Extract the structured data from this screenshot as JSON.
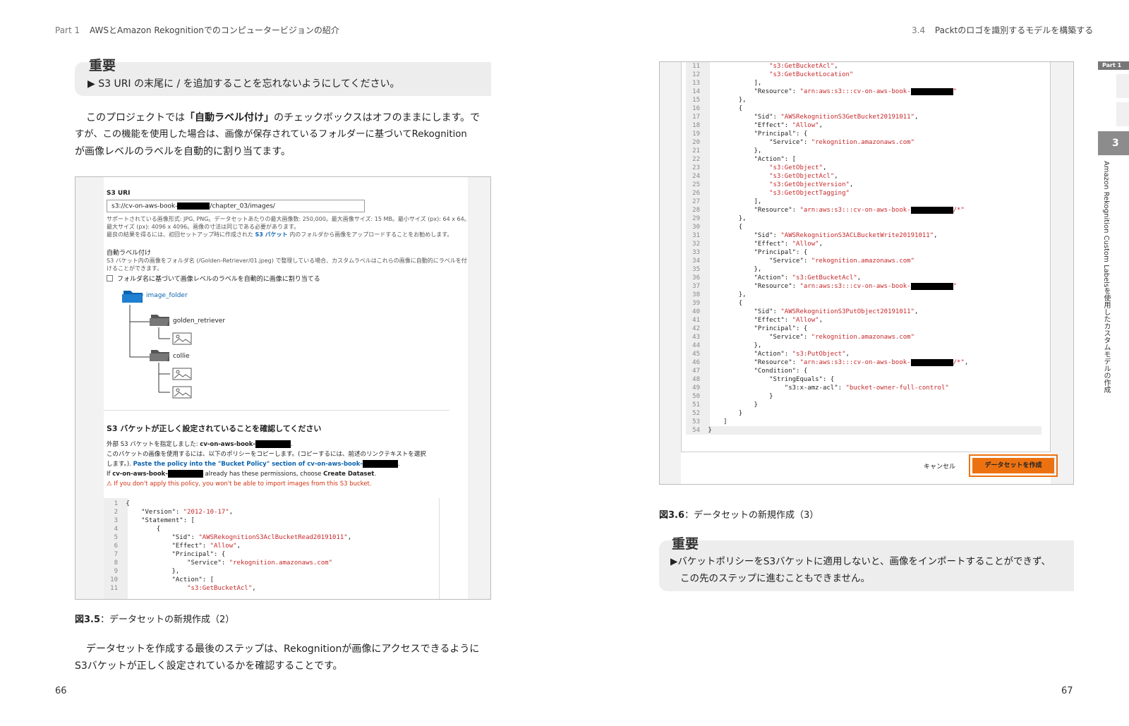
{
  "left_page": {
    "header": {
      "part": "Part 1",
      "title": "AWSとAmazon Rekognitionでのコンピュータービジョンの紹介"
    },
    "note": {
      "title": "重要",
      "text": "▶ S3 URI の末尾に / を追加することを忘れないようにしてください。"
    },
    "paragraph1": {
      "line1_pre": "このプロジェクトでは",
      "line1_bold": "「自動ラベル付け」",
      "line1_post": "のチェックボックスはオフのままにします。で",
      "line2": "すが、この機能を使用した場合は、画像が保存されているフォルダーに基づいてRekognition",
      "line3": "が画像レベルのラベルを自動的に割り当てます。"
    },
    "screenshot": {
      "s3_uri_label": "S3 URI",
      "s3_uri_prefix": "s3://cv-on-aws-book-",
      "s3_uri_suffix": "/chapter_03/images/",
      "help1": "サポートされている画像形式: JPG, PNG。データセットあたりの最大画像数: 250,000。最大画像サイズ: 15 MB。最小サイズ (px): 64 x 64。",
      "help2": "最大サイズ (px): 4096 x 4096。画像の寸法は同じである必要があります。",
      "help3_pre": "最良の結果を得るには、初回セットアップ時に作成された ",
      "help3_link": "S3 バケット",
      "help3_post": " 内のフォルダから画像をアップロードすることをお勧めします。",
      "auto_label_title": "自動ラベル付け",
      "auto_label_desc1": "S3 バケット内の画像をフォルダ名 (/Golden-Retriever/01.jpeg) で整理している場合、カスタムラベルはこれらの画像に自動的にラベルを付",
      "auto_label_desc2": "けることができます。",
      "checkbox_label": "フォルダ名に基づいて画像レベルのラベルを自動的に画像に割り当てる",
      "tree": {
        "root": "image_folder",
        "folder1": "golden_retriever",
        "folder2": "collie"
      },
      "bucket_title": "S3 バケットが正しく設定されていることを確認してください",
      "bucket_line1_pre": "外部 S3 バケットを指定しました: ",
      "bucket_line1_bold": "cv-on-aws-book-",
      "bucket_line2": "このバケットの画像を使用するには、以下のポリシーをコピーします。(コピーするには、前述のリンクテキストを選択",
      "bucket_line3_pre": "します。). ",
      "bucket_line3_link": "Paste the policy into the \"Bucket Policy\" section of cv-on-aws-book-",
      "bucket_line4_pre": "If ",
      "bucket_line4_bold": "cv-on-aws-book-",
      "bucket_line4_post": " already has these permissions, choose ",
      "bucket_line4_bold2": "Create Dataset",
      "warning": "If you don't apply this policy, you won't be able to import images from this S3 bucket.",
      "code": [
        {
          "n": "1",
          "t": "{"
        },
        {
          "n": "2",
          "t": "    \"Version\": ",
          "s": "\"2012-10-17\"",
          "e": ","
        },
        {
          "n": "3",
          "t": "    \"Statement\": ["
        },
        {
          "n": "4",
          "t": "        {"
        },
        {
          "n": "5",
          "t": "            \"Sid\": ",
          "s": "\"AWSRekognitionS3AclBucketRead20191011\"",
          "e": ","
        },
        {
          "n": "6",
          "t": "            \"Effect\": ",
          "s": "\"Allow\"",
          "e": ","
        },
        {
          "n": "7",
          "t": "            \"Principal\": {"
        },
        {
          "n": "8",
          "t": "                \"Service\": ",
          "s": "\"rekognition.amazonaws.com\""
        },
        {
          "n": "9",
          "t": "            },"
        },
        {
          "n": "10",
          "t": "            \"Action\": ["
        },
        {
          "n": "11",
          "t": "                ",
          "s": "\"s3:GetBucketAcl\"",
          "e": ","
        }
      ]
    },
    "caption": {
      "label": "図3.5",
      "text": "：データセットの新規作成（2）"
    },
    "paragraph2": {
      "line1": "データセットを作成する最後のステップは、Rekognitionが画像にアクセスできるように",
      "line2": "S3バケットが正しく設定されているかを確認することです。"
    },
    "page_number": "66"
  },
  "right_page": {
    "header": {
      "section": "3.4",
      "title": "Packtのロゴを識別するモデルを構築する"
    },
    "code": [
      {
        "n": "11",
        "t": "                ",
        "s": "\"s3:GetBucketAcl\"",
        "e": ","
      },
      {
        "n": "12",
        "t": "                ",
        "s": "\"s3:GetBucketLocation\""
      },
      {
        "n": "13",
        "t": "            ],"
      },
      {
        "n": "14",
        "t": "            \"Resource\": ",
        "s": "\"arn:aws:s3:::cv-on-aws-book-",
        "r": true,
        "s2": "\""
      },
      {
        "n": "15",
        "t": "        },"
      },
      {
        "n": "16",
        "t": "        {"
      },
      {
        "n": "17",
        "t": "            \"Sid\": ",
        "s": "\"AWSRekognitionS3GetBucket20191011\"",
        "e": ","
      },
      {
        "n": "18",
        "t": "            \"Effect\": ",
        "s": "\"Allow\"",
        "e": ","
      },
      {
        "n": "19",
        "t": "            \"Principal\": {"
      },
      {
        "n": "20",
        "t": "                \"Service\": ",
        "s": "\"rekognition.amazonaws.com\""
      },
      {
        "n": "21",
        "t": "            },"
      },
      {
        "n": "22",
        "t": "            \"Action\": ["
      },
      {
        "n": "23",
        "t": "                ",
        "s": "\"s3:GetObject\"",
        "e": ","
      },
      {
        "n": "24",
        "t": "                ",
        "s": "\"s3:GetObjectAcl\"",
        "e": ","
      },
      {
        "n": "25",
        "t": "                ",
        "s": "\"s3:GetObjectVersion\"",
        "e": ","
      },
      {
        "n": "26",
        "t": "                ",
        "s": "\"s3:GetObjectTagging\""
      },
      {
        "n": "27",
        "t": "            ],"
      },
      {
        "n": "28",
        "t": "            \"Resource\": ",
        "s": "\"arn:aws:s3:::cv-on-aws-book-",
        "r": true,
        "s2": "/*\""
      },
      {
        "n": "29",
        "t": "        },"
      },
      {
        "n": "30",
        "t": "        {"
      },
      {
        "n": "31",
        "t": "            \"Sid\": ",
        "s": "\"AWSRekognitionS3ACLBucketWrite20191011\"",
        "e": ","
      },
      {
        "n": "32",
        "t": "            \"Effect\": ",
        "s": "\"Allow\"",
        "e": ","
      },
      {
        "n": "33",
        "t": "            \"Principal\": {"
      },
      {
        "n": "34",
        "t": "                \"Service\": ",
        "s": "\"rekognition.amazonaws.com\""
      },
      {
        "n": "35",
        "t": "            },"
      },
      {
        "n": "36",
        "t": "            \"Action\": ",
        "s": "\"s3:GetBucketAcl\"",
        "e": ","
      },
      {
        "n": "37",
        "t": "            \"Resource\": ",
        "s": "\"arn:aws:s3:::cv-on-aws-book-",
        "r": true,
        "s2": "\""
      },
      {
        "n": "38",
        "t": "        },"
      },
      {
        "n": "39",
        "t": "        {"
      },
      {
        "n": "40",
        "t": "            \"Sid\": ",
        "s": "\"AWSRekognitionS3PutObject20191011\"",
        "e": ","
      },
      {
        "n": "41",
        "t": "            \"Effect\": ",
        "s": "\"Allow\"",
        "e": ","
      },
      {
        "n": "42",
        "t": "            \"Principal\": {"
      },
      {
        "n": "43",
        "t": "                \"Service\": ",
        "s": "\"rekognition.amazonaws.com\""
      },
      {
        "n": "44",
        "t": "            },"
      },
      {
        "n": "45",
        "t": "            \"Action\": ",
        "s": "\"s3:PutObject\"",
        "e": ","
      },
      {
        "n": "46",
        "t": "            \"Resource\": ",
        "s": "\"arn:aws:s3:::cv-on-aws-book-",
        "r": true,
        "s2": "/*\"",
        "e": ","
      },
      {
        "n": "47",
        "t": "            \"Condition\": {"
      },
      {
        "n": "48",
        "t": "                \"StringEquals\": {"
      },
      {
        "n": "49",
        "t": "                    \"s3:x-amz-acl\": ",
        "s": "\"bucket-owner-full-control\""
      },
      {
        "n": "50",
        "t": "                }"
      },
      {
        "n": "51",
        "t": "            }"
      },
      {
        "n": "52",
        "t": "        }"
      },
      {
        "n": "53",
        "t": "    ]"
      },
      {
        "n": "54",
        "t": "}"
      }
    ],
    "cancel_label": "キャンセル",
    "create_label": "データセットを作成",
    "caption": {
      "label": "図3.6",
      "text": "：データセットの新規作成（3）"
    },
    "note": {
      "title": "重要",
      "line1": "▶バケットポリシーをS3バケットに適用しないと、画像をインポートすることができず、",
      "line2": "この先のステップに進むこともできません。"
    },
    "side": {
      "part": "Part 1",
      "chapter": "3",
      "title": "Amazon Rekognition Custom Labelsを使用したカスタムモデルの作成"
    },
    "page_number": "67"
  },
  "colors": {
    "accent_orange": "#ec7211",
    "code_red": "#c7282a",
    "link_blue": "#0b64b0"
  }
}
